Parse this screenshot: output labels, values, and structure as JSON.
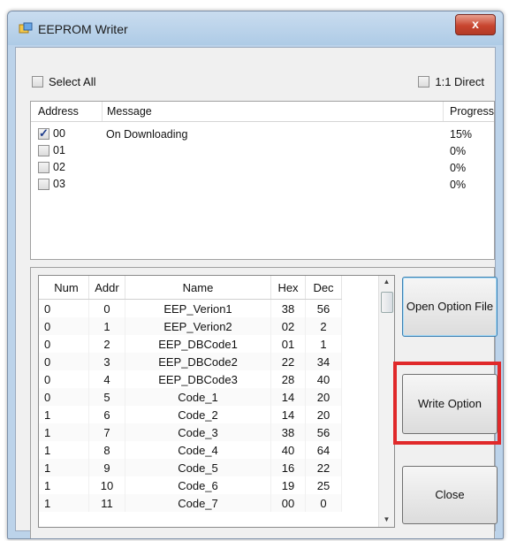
{
  "window": {
    "title": "EEPROM Writer",
    "close_symbol": "x"
  },
  "options": {
    "select_all_label": "Select All",
    "select_all_checked": false,
    "direct_label": "1:1 Direct",
    "direct_checked": false
  },
  "status_list": {
    "columns": [
      "Address",
      "Message",
      "Progress"
    ],
    "rows": [
      {
        "address": "00",
        "checked": true,
        "message": "On Downloading",
        "progress": "15%"
      },
      {
        "address": "01",
        "checked": false,
        "message": "",
        "progress": "0%"
      },
      {
        "address": "02",
        "checked": false,
        "message": "",
        "progress": "0%"
      },
      {
        "address": "03",
        "checked": false,
        "message": "",
        "progress": "0%"
      }
    ]
  },
  "option_table": {
    "columns": [
      "Num",
      "Addr",
      "Name",
      "Hex",
      "Dec"
    ],
    "rows": [
      [
        "0",
        "0",
        "EEP_Verion1",
        "38",
        "56"
      ],
      [
        "0",
        "1",
        "EEP_Verion2",
        "02",
        "2"
      ],
      [
        "0",
        "2",
        "EEP_DBCode1",
        "01",
        "1"
      ],
      [
        "0",
        "3",
        "EEP_DBCode2",
        "22",
        "34"
      ],
      [
        "0",
        "4",
        "EEP_DBCode3",
        "28",
        "40"
      ],
      [
        "0",
        "5",
        "Code_1",
        "14",
        "20"
      ],
      [
        "1",
        "6",
        "Code_2",
        "14",
        "20"
      ],
      [
        "1",
        "7",
        "Code_3",
        "38",
        "56"
      ],
      [
        "1",
        "8",
        "Code_4",
        "40",
        "64"
      ],
      [
        "1",
        "9",
        "Code_5",
        "16",
        "22"
      ],
      [
        "1",
        "10",
        "Code_6",
        "19",
        "25"
      ],
      [
        "1",
        "11",
        "Code_7",
        "00",
        "0"
      ]
    ]
  },
  "buttons": {
    "open_option_file": "Open Option File",
    "write_option": "Write Option",
    "close": "Close"
  },
  "colors": {
    "highlight": "#e0292a",
    "title_close": "#c8452f",
    "window_frame": "#bcd3ea"
  }
}
